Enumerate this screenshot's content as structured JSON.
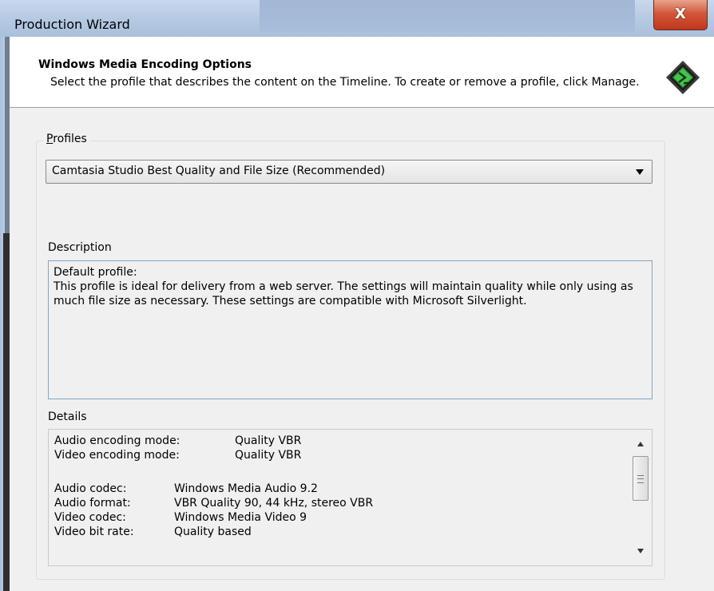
{
  "window": {
    "title": "Production Wizard",
    "close_glyph": "X"
  },
  "header": {
    "title": "Windows Media Encoding Options",
    "subtitle": "Select the profile that describes the content on the Timeline.  To create or remove a profile, click Manage.",
    "icon": "camtasia-logo-icon"
  },
  "profiles": {
    "group_label_prefix": "P",
    "group_label_rest": "rofiles",
    "selected": "Camtasia Studio Best Quality and File Size (Recommended)"
  },
  "description": {
    "label": "Description",
    "line1": "Default profile:",
    "line2": "This profile is ideal for delivery from a web server.  The settings will maintain quality while only using as much file size as necessary.  These settings are compatible with Microsoft Silverlight."
  },
  "details": {
    "label": "Details",
    "rows": [
      {
        "key": "Audio encoding mode:",
        "value": "Quality VBR"
      },
      {
        "key": "Video encoding mode:",
        "value": "Quality VBR"
      },
      {
        "key": "Audio codec:",
        "value": "Windows Media Audio 9.2"
      },
      {
        "key": "Audio format:",
        "value": "VBR Quality 90, 44 kHz, stereo VBR"
      },
      {
        "key": "Video codec:",
        "value": "Windows Media Video 9"
      },
      {
        "key": "Video bit rate:",
        "value": "Quality based"
      }
    ]
  },
  "colors": {
    "close_red": "#c0371d",
    "accent_border": "#7ea6c9"
  }
}
